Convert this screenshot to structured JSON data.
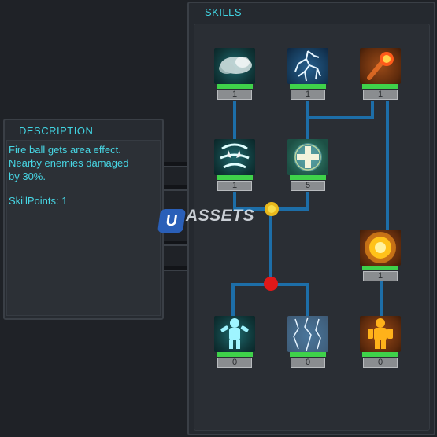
{
  "skills": {
    "title": "SKILLS",
    "nodes": [
      {
        "id": "smoke",
        "level": "1"
      },
      {
        "id": "lightning",
        "level": "1"
      },
      {
        "id": "fireball",
        "level": "1"
      },
      {
        "id": "tornado",
        "level": "1"
      },
      {
        "id": "heal-cross",
        "level": "5"
      },
      {
        "id": "fire-explosion",
        "level": "1"
      },
      {
        "id": "ice-golem",
        "level": "0"
      },
      {
        "id": "storm-field",
        "level": "0"
      },
      {
        "id": "fire-golem",
        "level": "0"
      }
    ],
    "colors": {
      "connector": "#1d6ea8",
      "accent": "#41d4e2",
      "bar": "#3fd24a",
      "junction_red": "#e01818",
      "junction_gold": "#e8b81c"
    }
  },
  "description": {
    "title": "DESCRIPTION",
    "text": "Fire  ball gets area effect.\nNearby enemies damaged\nby 30%.",
    "skill_points": "SkillPoints: 1"
  },
  "watermark": {
    "badge": "U",
    "text": "ASSETS"
  }
}
